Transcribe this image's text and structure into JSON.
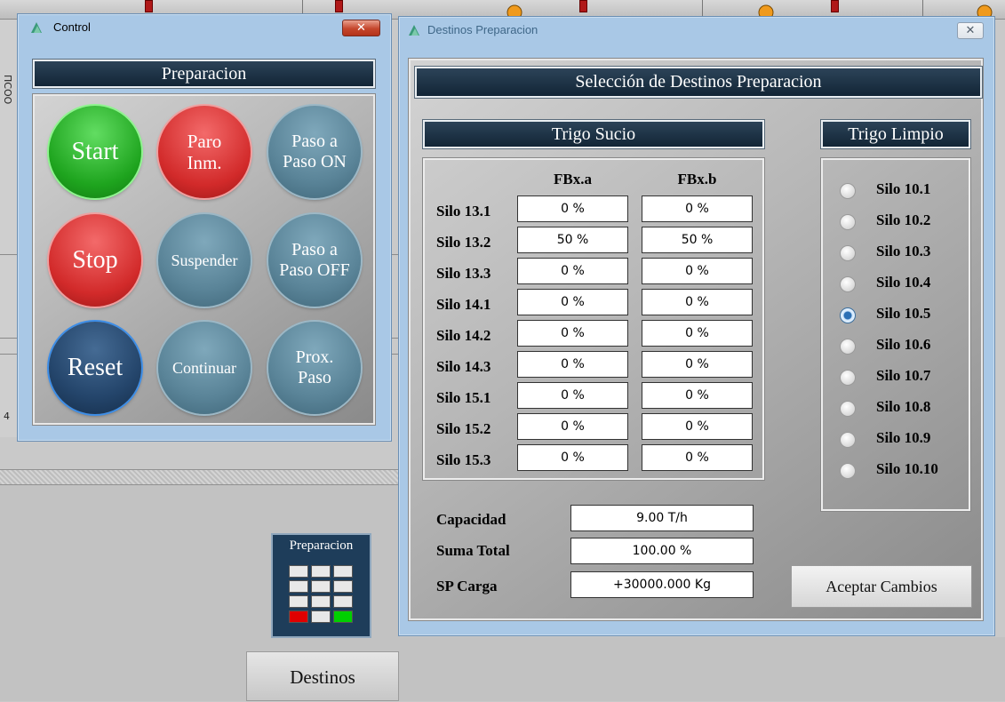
{
  "colors": {
    "window_frame": "#a9c8e6",
    "header_dark": "#1e3448",
    "start": "#1ea41e",
    "stop": "#d22a2a",
    "reset": "#24456b",
    "neutral_button": "#5a8498"
  },
  "background": {
    "side_texts": [
      "ПСОО",
      "4"
    ],
    "preparacion_icon_label": "Preparacion",
    "destinos_button": "Destinos"
  },
  "control_window": {
    "title": "Control",
    "close_icon": "close-icon",
    "header": "Preparacion",
    "buttons": [
      {
        "id": "start",
        "label": "Start"
      },
      {
        "id": "paro",
        "label": "Paro\nInm."
      },
      {
        "id": "paso_on",
        "label": "Paso a\nPaso ON"
      },
      {
        "id": "stop",
        "label": "Stop"
      },
      {
        "id": "suspender",
        "label": "Suspender"
      },
      {
        "id": "paso_off",
        "label": "Paso a\nPaso OFF"
      },
      {
        "id": "reset",
        "label": "Reset"
      },
      {
        "id": "continuar",
        "label": "Continuar"
      },
      {
        "id": "prox",
        "label": "Prox.\nPaso"
      }
    ]
  },
  "destinos_window": {
    "title": "Destinos Preparacion",
    "header": "Selección de Destinos Preparacion",
    "trigo_sucio": {
      "title": "Trigo Sucio",
      "columns": [
        "FBx.a",
        "FBx.b"
      ],
      "rows": [
        {
          "label": "Silo 13.1",
          "a": "0 %",
          "b": "0 %"
        },
        {
          "label": "Silo 13.2",
          "a": "50 %",
          "b": "50 %"
        },
        {
          "label": "Silo 13.3",
          "a": "0 %",
          "b": "0 %"
        },
        {
          "label": "Silo 14.1",
          "a": "0 %",
          "b": "0 %"
        },
        {
          "label": "Silo 14.2",
          "a": "0 %",
          "b": "0 %"
        },
        {
          "label": "Silo 14.3",
          "a": "0 %",
          "b": "0 %"
        },
        {
          "label": "Silo 15.1",
          "a": "0 %",
          "b": "0 %"
        },
        {
          "label": "Silo 15.2",
          "a": "0 %",
          "b": "0 %"
        },
        {
          "label": "Silo 15.3",
          "a": "0 %",
          "b": "0 %"
        }
      ]
    },
    "summary": {
      "capacidad_label": "Capacidad",
      "capacidad_value": "9.00 T/h",
      "suma_label": "Suma Total",
      "suma_value": "100.00 %",
      "sp_label": "SP Carga",
      "sp_value": "+30000.000 Kg"
    },
    "trigo_limpio": {
      "title": "Trigo Limpio",
      "selected": "Silo 10.5",
      "options": [
        "Silo 10.1",
        "Silo 10.2",
        "Silo 10.3",
        "Silo 10.4",
        "Silo 10.5",
        "Silo 10.6",
        "Silo 10.7",
        "Silo 10.8",
        "Silo 10.9",
        "Silo 10.10"
      ]
    },
    "accept_button": "Aceptar Cambios"
  }
}
